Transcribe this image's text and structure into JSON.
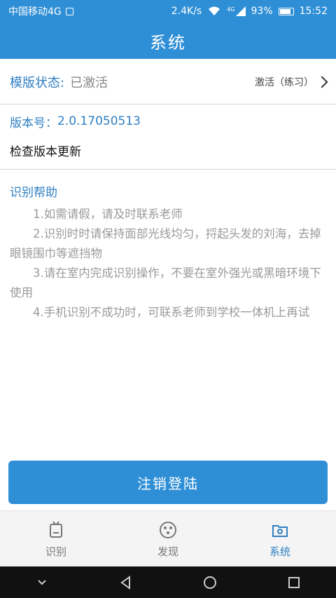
{
  "status_bar": {
    "carrier": "中国移动4G",
    "speed": "2.4K/s",
    "network_badge": "4G",
    "battery": "93%",
    "battery_level": 0.93,
    "time": "15:52"
  },
  "header": {
    "title": "系统"
  },
  "template_status": {
    "label": "模版状态:",
    "value": "已激活",
    "action": "激活（练习）"
  },
  "version": {
    "label": "版本号：",
    "value": "2.0.17050513"
  },
  "update": {
    "label": "检查版本更新"
  },
  "help": {
    "title": "识别帮助",
    "items": [
      "1.如需请假，请及时联系老师",
      "2.识别时时请保持面部光线均匀，捋起头发的刘海，去掉眼镜围巾等遮挡物",
      "3.请在室内完成识别操作，不要在室外强光或黑暗环境下使用",
      "4.手机识别不成功时，可联系老师到学校一体机上再试"
    ]
  },
  "logout_label": "注销登陆",
  "tabs": [
    {
      "label": "识别",
      "icon": "recognize-icon"
    },
    {
      "label": "发现",
      "icon": "discover-icon"
    },
    {
      "label": "系统",
      "icon": "system-icon",
      "active": true
    }
  ],
  "nav_icons": [
    "chevron-down-icon",
    "back-icon",
    "home-icon",
    "recent-apps-icon"
  ],
  "colors": {
    "primary": "#2f8fd6",
    "label_blue": "#2f7fc3",
    "muted": "#9a9a9a"
  }
}
